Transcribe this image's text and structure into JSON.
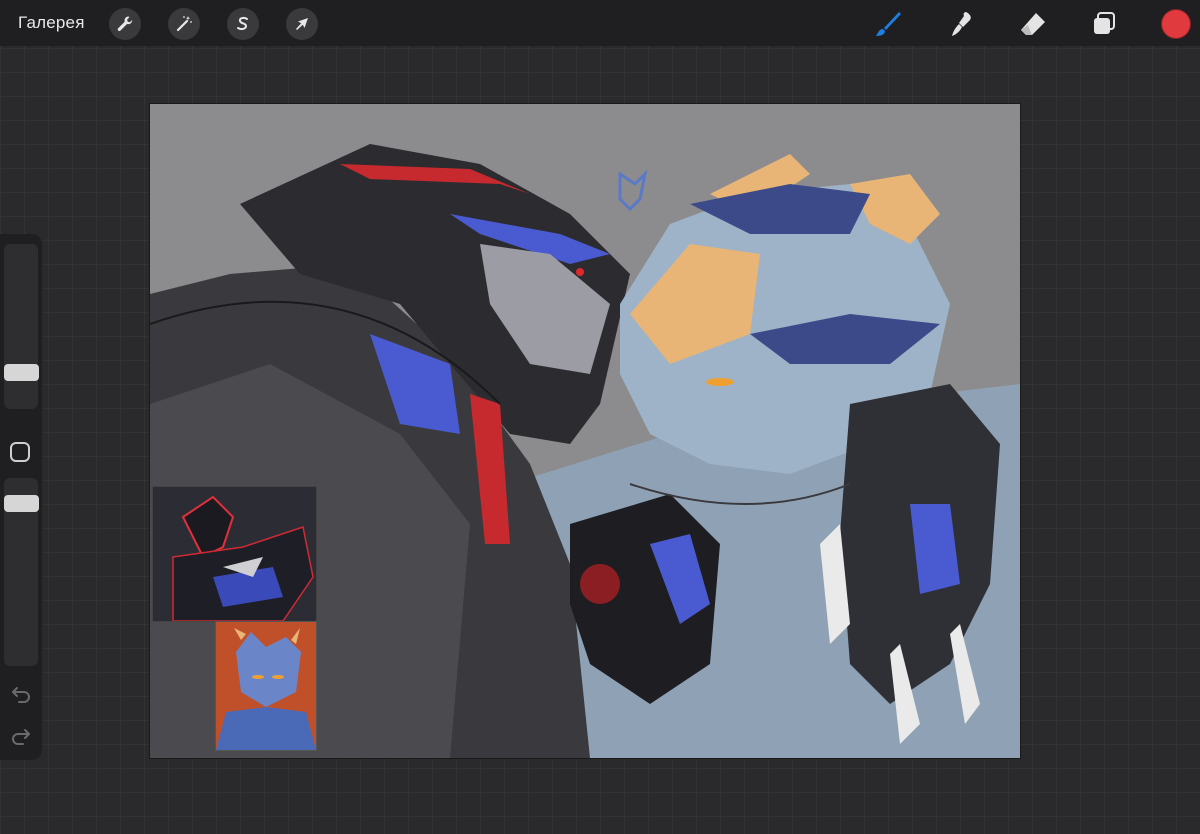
{
  "topbar": {
    "gallery_label": "Галерея",
    "left_tools": [
      {
        "name": "actions",
        "icon": "wrench-icon"
      },
      {
        "name": "adjustments",
        "icon": "magic-wand-icon"
      },
      {
        "name": "selection",
        "icon": "selection-s-icon"
      },
      {
        "name": "transform",
        "icon": "cursor-arrow-icon"
      }
    ],
    "right_tools": [
      {
        "name": "brush",
        "icon": "brush-icon",
        "active": true
      },
      {
        "name": "smudge",
        "icon": "smudge-icon",
        "active": false
      },
      {
        "name": "eraser",
        "icon": "eraser-icon",
        "active": false
      },
      {
        "name": "layers",
        "icon": "layers-icon",
        "active": false
      }
    ],
    "current_color": "#e03a3e",
    "accent_color": "#1e7fe0"
  },
  "sidebar": {
    "brush_size_icon": "size-slider",
    "modify_icon": "square-icon",
    "opacity_icon": "opacity-slider",
    "undo_icon": "undo-icon",
    "redo_icon": "redo-icon"
  },
  "canvas": {
    "background": "#8c8c8e",
    "reference_images": [
      {
        "name": "reference-dark-robot",
        "background": "#2c2c34"
      },
      {
        "name": "reference-blue-robot",
        "background": "#c0502a"
      }
    ]
  }
}
